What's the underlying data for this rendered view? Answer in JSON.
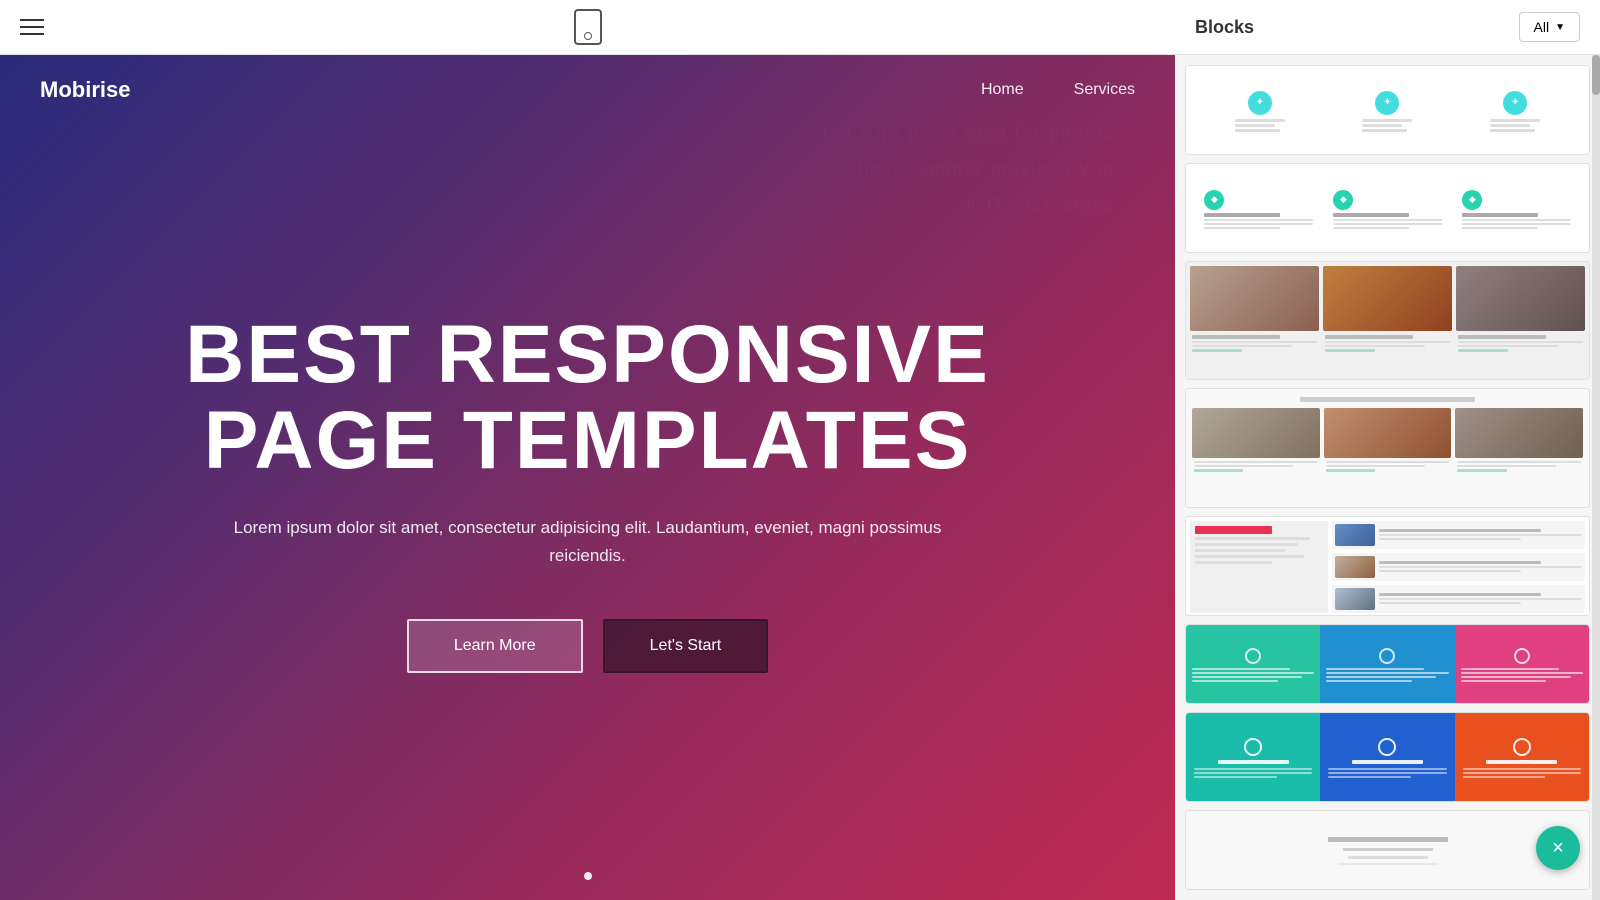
{
  "toolbar": {
    "device_label": "mobile device",
    "hamburger_label": "menu"
  },
  "hero": {
    "logo": "Mobirise",
    "nav": {
      "home": "Home",
      "services": "Services"
    },
    "title_line1": "BEST RESPONSIVE",
    "title_line2": "PAGE TEMPLATES",
    "subtitle": "Lorem ipsum dolor sit amet, consectetur adipisicing elit. Laudantium, eveniet, magni possimus reiciendis.",
    "btn_learn": "Learn More",
    "btn_start": "Let's Start"
  },
  "blocks_panel": {
    "title": "Blocks",
    "filter_label": "All"
  },
  "close_btn": "×"
}
